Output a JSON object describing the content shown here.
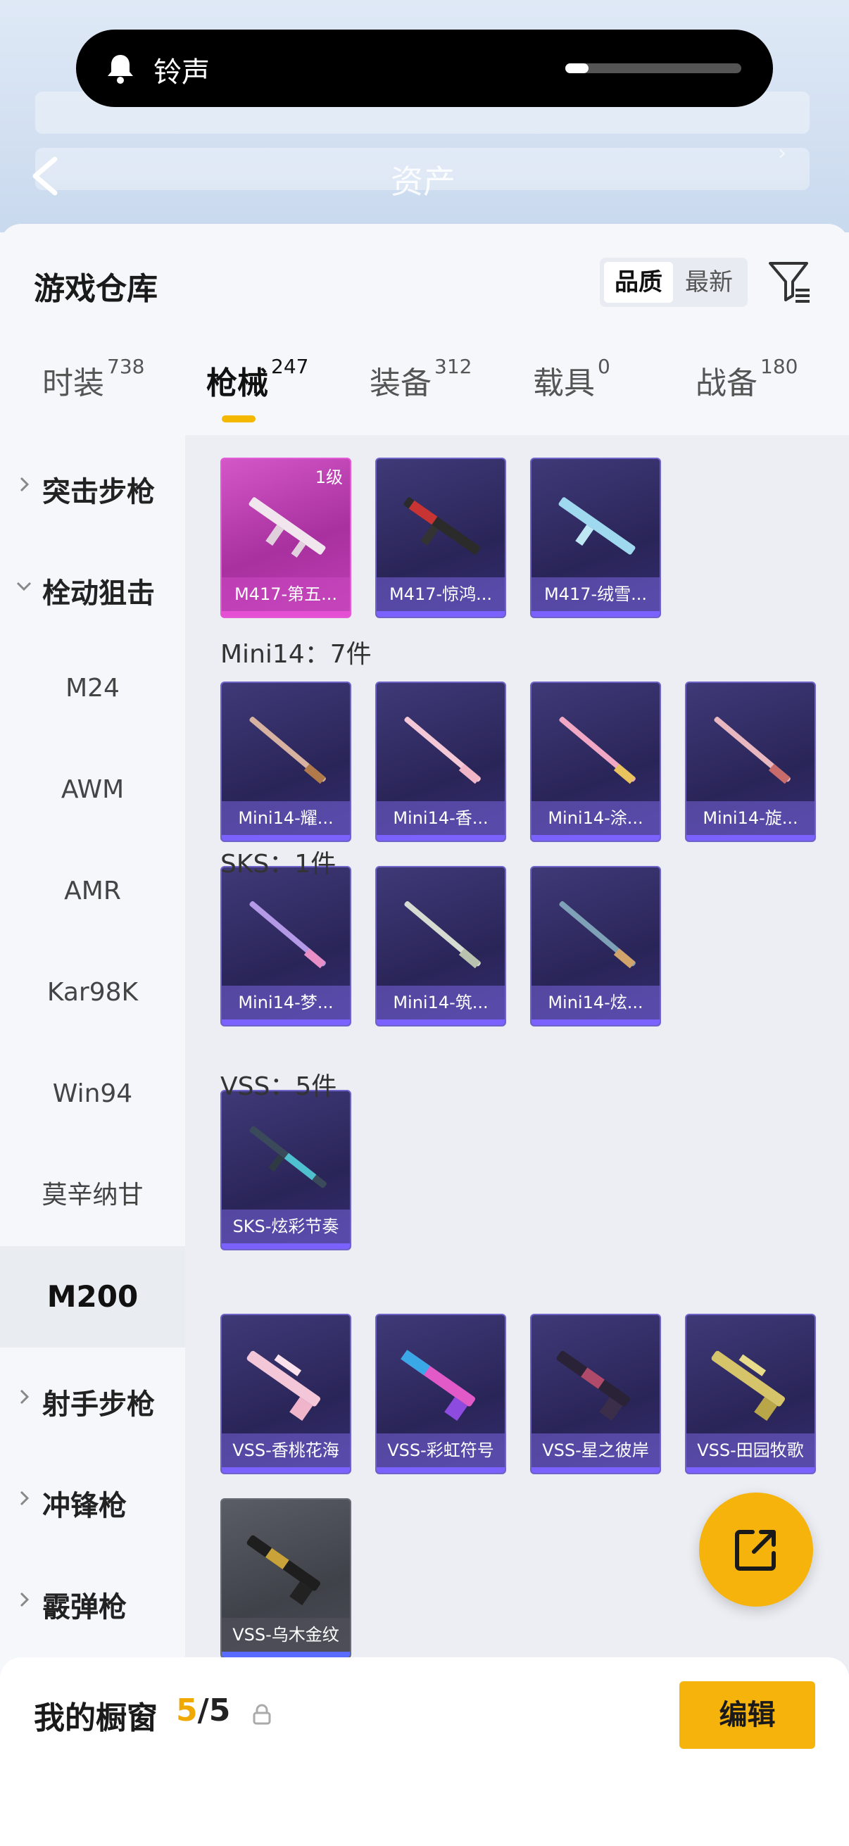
{
  "toast": {
    "label": "铃声",
    "volume_fraction": 0.13
  },
  "header": {
    "title": "资产"
  },
  "warehouse": {
    "title": "游戏仓库",
    "sort_options": [
      "品质",
      "最新"
    ],
    "tabs": [
      {
        "label": "时装",
        "count": "738"
      },
      {
        "label": "枪械",
        "count": "247"
      },
      {
        "label": "装备",
        "count": "312"
      },
      {
        "label": "载具",
        "count": "0"
      },
      {
        "label": "战备",
        "count": "180"
      }
    ]
  },
  "sidebar": {
    "categories": {
      "assault": "突击步枪",
      "bolt": "栓动狙击",
      "marksman": "射手步枪",
      "smg": "冲锋枪",
      "shotgun": "霰弹枪"
    },
    "sub_items": [
      "M24",
      "AWM",
      "AMR",
      "Kar98K",
      "Win94",
      "莫辛纳甘",
      "M200"
    ]
  },
  "groups": {
    "mini14": "Mini14：7件",
    "sks": "SKS：1件",
    "vss": "VSS：5件"
  },
  "cards": {
    "m417": [
      {
        "name": "M417-第五...",
        "level": "1级"
      },
      {
        "name": "M417-惊鸿..."
      },
      {
        "name": "M417-绒雪..."
      }
    ],
    "mini14": [
      {
        "name": "Mini14-耀..."
      },
      {
        "name": "Mini14-香..."
      },
      {
        "name": "Mini14-涂..."
      },
      {
        "name": "Mini14-旋..."
      },
      {
        "name": "Mini14-梦..."
      },
      {
        "name": "Mini14-筑..."
      },
      {
        "name": "Mini14-炫..."
      }
    ],
    "sks": [
      {
        "name": "SKS-炫彩节奏"
      }
    ],
    "vss": [
      {
        "name": "VSS-香桃花海"
      },
      {
        "name": "VSS-彩虹符号"
      },
      {
        "name": "VSS-星之彼岸"
      },
      {
        "name": "VSS-田园牧歌"
      },
      {
        "name": "VSS-乌木金纹"
      }
    ]
  },
  "showcase": {
    "title": "我的橱窗",
    "count_current": "5",
    "count_sep": "/",
    "count_max": "5",
    "edit_label": "编辑"
  }
}
